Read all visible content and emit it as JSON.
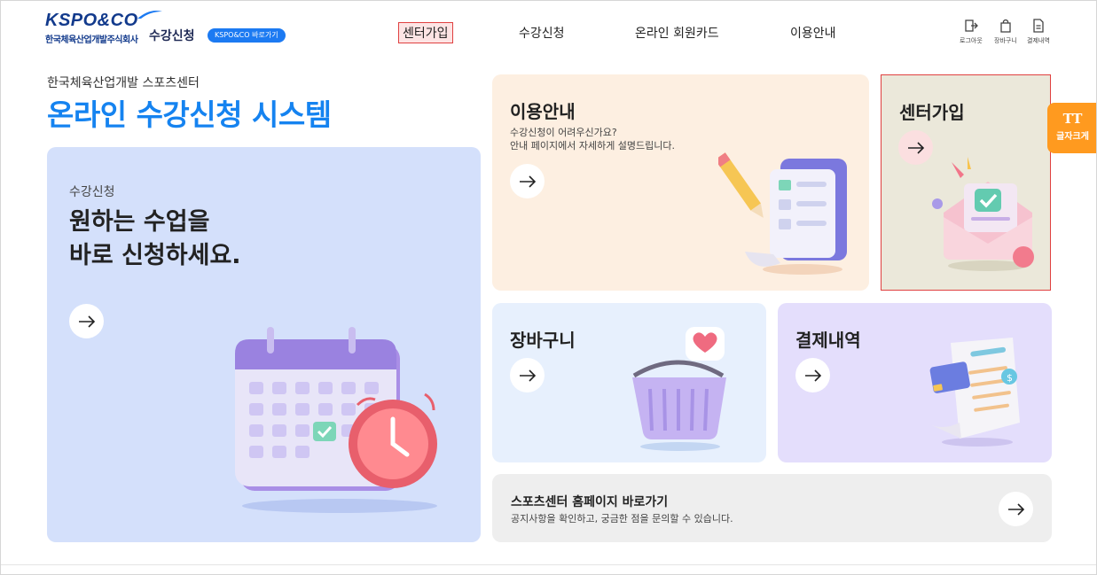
{
  "header": {
    "logo_text": "KSPO&CO",
    "logo_sub": "한국체육산업개발주식회사",
    "site_name": "수강신청",
    "shortcut_label": "KSPO&CO 바로가기"
  },
  "nav": [
    {
      "label": "센터가입",
      "active": true
    },
    {
      "label": "수강신청"
    },
    {
      "label": "온라인 회원카드"
    },
    {
      "label": "이용안내"
    }
  ],
  "utility": [
    {
      "label": "로그아웃",
      "icon": "logout-icon"
    },
    {
      "label": "장바구니",
      "icon": "bag-icon"
    },
    {
      "label": "결제내역",
      "icon": "document-icon"
    }
  ],
  "hero": {
    "subtitle": "한국체육산업개발 스포츠센터",
    "title": "온라인 수강신청 시스템"
  },
  "cards": {
    "apply": {
      "label": "수강신청",
      "headline_1": "원하는 수업을",
      "headline_2": "바로 신청하세요."
    },
    "guide": {
      "title": "이용안내",
      "desc_1": "수강신청이 어려우신가요?",
      "desc_2": "안내 페이지에서 자세하게 설명드립니다."
    },
    "join": {
      "title": "센터가입"
    },
    "cart": {
      "title": "장바구니"
    },
    "payment": {
      "title": "결제내역"
    },
    "homepage": {
      "title": "스포츠센터 홈페이지 바로가기",
      "desc": "공지사항을 확인하고, 궁금한 점을 문의할 수 있습니다."
    }
  },
  "font_size_button": {
    "icon_text": "TT",
    "label": "글자크게"
  },
  "colors": {
    "brand_blue": "#1583f0",
    "orange": "#ff9a1f",
    "highlight_red": "#e04040"
  }
}
